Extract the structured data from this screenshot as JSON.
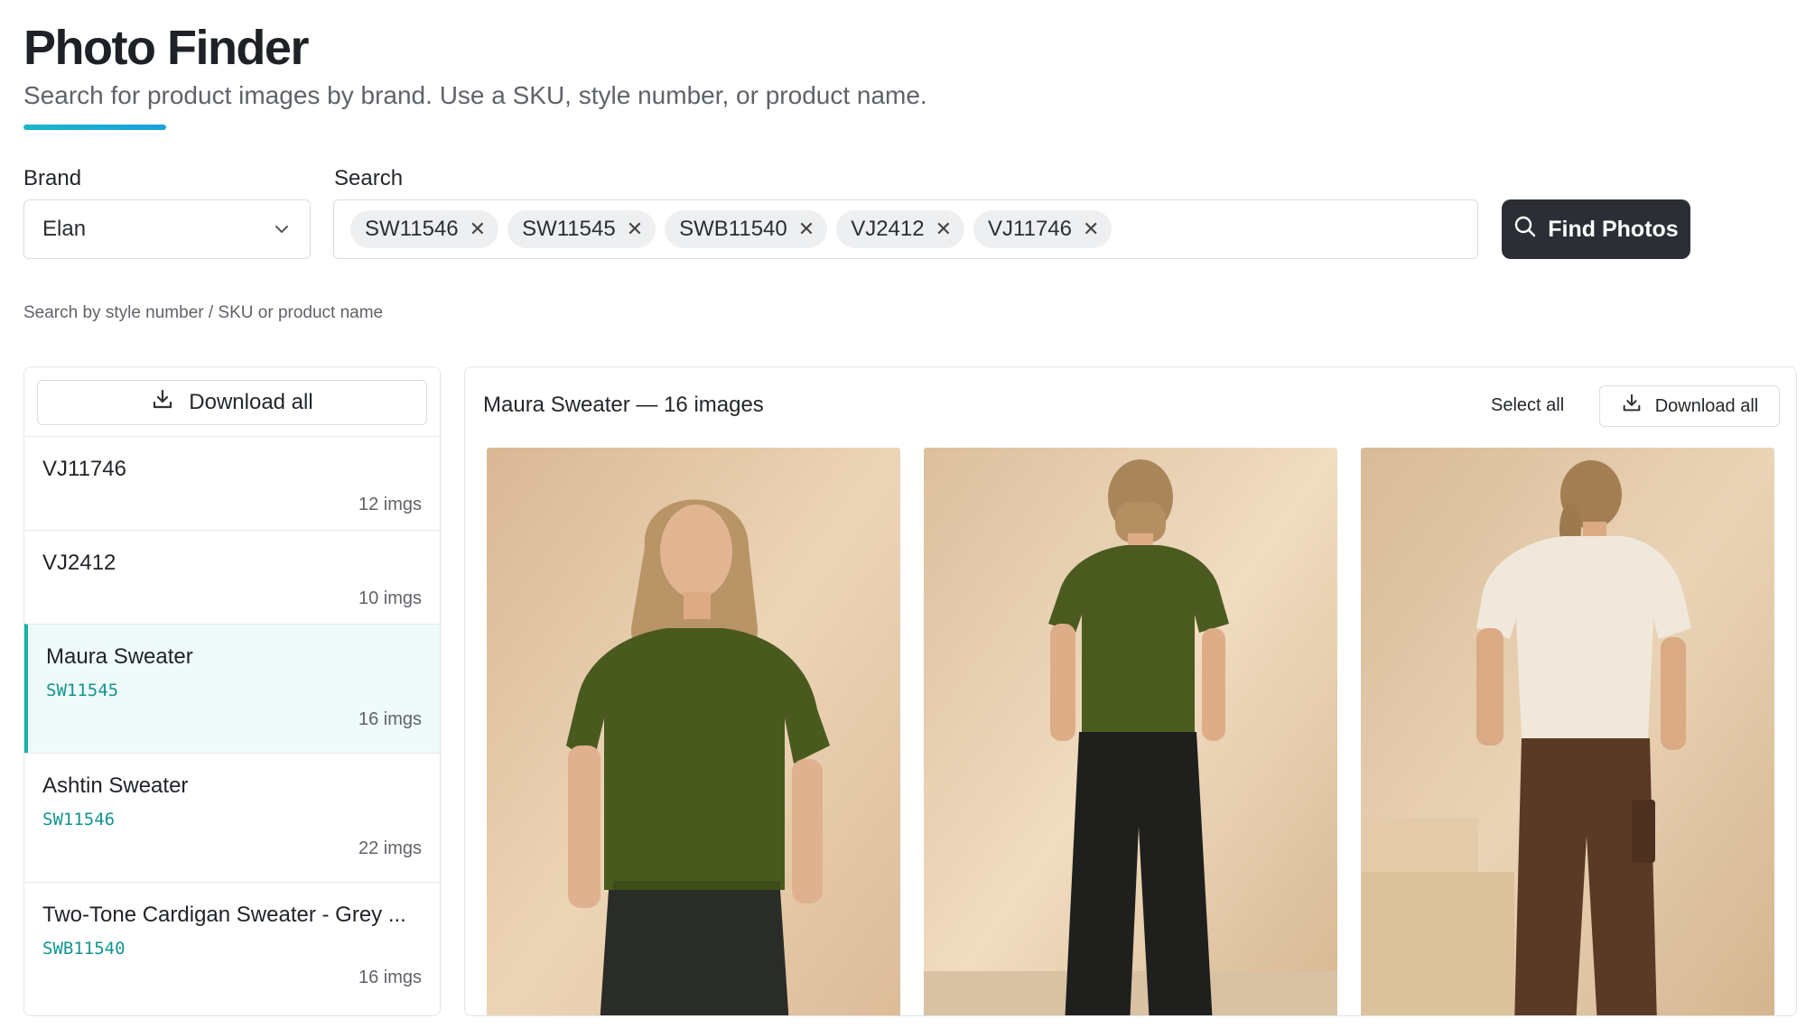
{
  "header": {
    "title": "Photo Finder",
    "subtitle": "Search for product images by brand. Use a SKU, style number, or product name."
  },
  "form": {
    "brand_label": "Brand",
    "brand_value": "Elan",
    "search_label": "Search",
    "chips": [
      "SW11546",
      "SW11545",
      "SWB11540",
      "VJ2412",
      "VJ11746"
    ],
    "find_button": "Find Photos",
    "hint": "Search by style number / SKU or product name"
  },
  "sidebar": {
    "download_all": "Download all",
    "items": [
      {
        "name": "VJ11746",
        "sku": "",
        "count": "12 imgs"
      },
      {
        "name": "VJ2412",
        "sku": "",
        "count": "10 imgs"
      },
      {
        "name": "Maura Sweater",
        "sku": "SW11545",
        "count": "16 imgs"
      },
      {
        "name": "Ashtin Sweater",
        "sku": "SW11546",
        "count": "22 imgs"
      },
      {
        "name": "Two-Tone Cardigan Sweater - Grey ...",
        "sku": "SWB11540",
        "count": "16 imgs"
      }
    ]
  },
  "gallery": {
    "title": "Maura Sweater — 16 images",
    "select_all": "Select all",
    "download_all": "Download all"
  },
  "colors": {
    "accent": "#17b3a3",
    "sku_text": "#12958f",
    "button_dark": "#2b2f35"
  }
}
